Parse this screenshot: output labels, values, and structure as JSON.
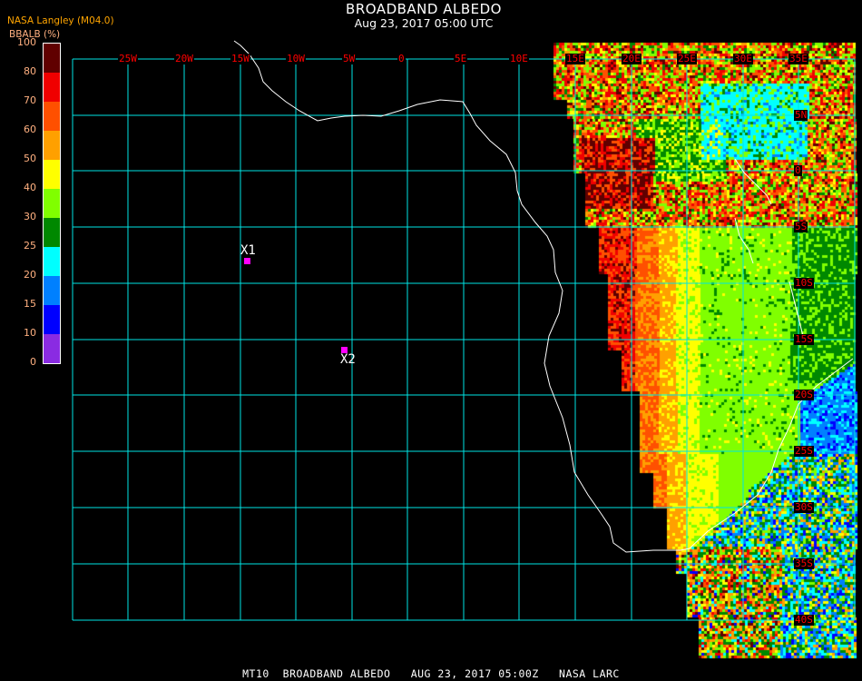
{
  "header": {
    "title": "BROADBAND ALBEDO",
    "subtitle": "Aug 23, 2017 05:00 UTC",
    "credit": "NASA Langley (M04.0)"
  },
  "colorbar": {
    "units": "BBALB (%)",
    "labels": [
      "100",
      "80",
      "70",
      "60",
      "50",
      "40",
      "30",
      "25",
      "20",
      "15",
      "10",
      "0"
    ],
    "colors": [
      "#600000",
      "#f00000",
      "#ff5000",
      "#ffa000",
      "#ffff00",
      "#80ff00",
      "#008800",
      "#00ffff",
      "#0080ff",
      "#0000ff",
      "#8a2be2"
    ]
  },
  "map": {
    "grid_color": "#00e5e5",
    "label_color": "#ff0000",
    "coast_color": "#ffffff",
    "lon_labels": [
      "25W",
      "20W",
      "15W",
      "10W",
      "5W",
      "0",
      "5E",
      "10E",
      "15E",
      "20E",
      "25E",
      "30E",
      "35E"
    ],
    "lat_labels": [
      "5N",
      "0",
      "5S",
      "10S",
      "15S",
      "20S",
      "25S",
      "30S",
      "35S",
      "40S"
    ],
    "markers": [
      {
        "label": "X1",
        "color": "#ff00ff"
      },
      {
        "label": "X2",
        "color": "#ff00ff"
      }
    ]
  },
  "footer": "MT10  BROADBAND ALBEDO   AUG 23, 2017 05:00Z   NASA LARC"
}
